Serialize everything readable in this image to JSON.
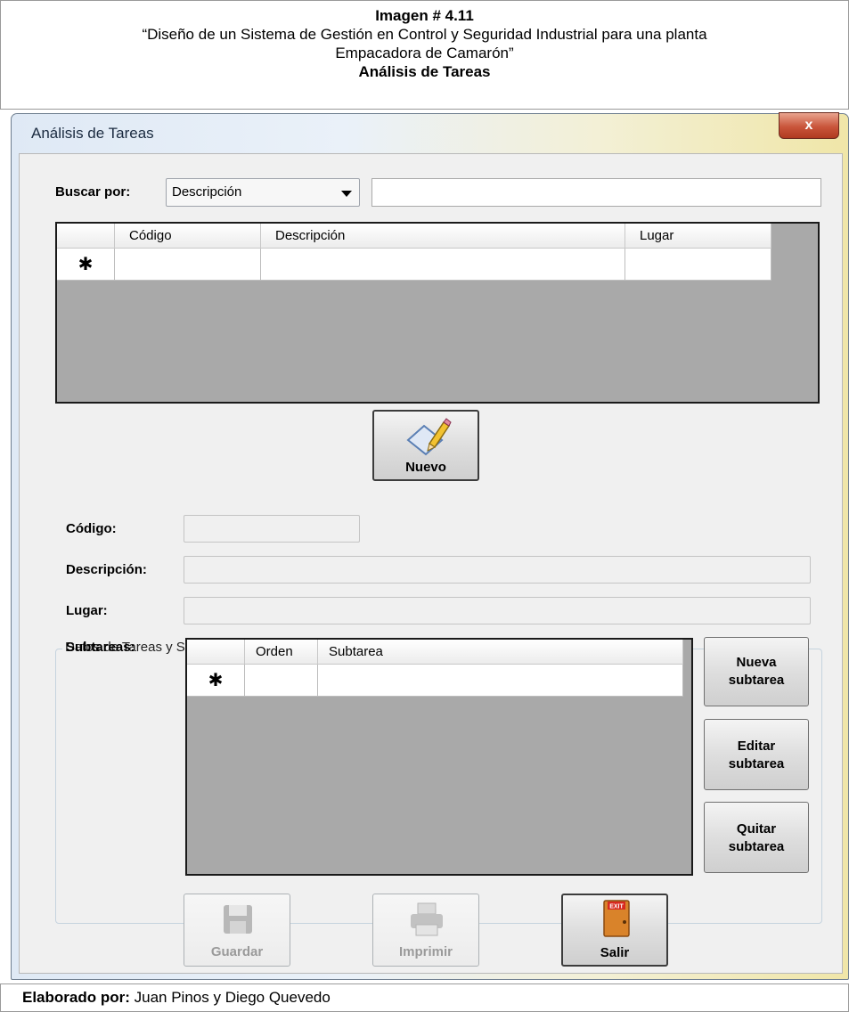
{
  "caption": {
    "line1": "Imagen # 4.11",
    "line2": "“Diseño de un Sistema de Gestión en Control y Seguridad Industrial para una planta",
    "line3": "Empacadora de Camarón”",
    "line4": "Análisis de Tareas"
  },
  "window": {
    "title": "Análisis de Tareas",
    "close_glyph": "x"
  },
  "search": {
    "label": "Buscar por:",
    "combo_value": "Descripción",
    "text_value": ""
  },
  "main_grid": {
    "columns": [
      "Código",
      "Descripción",
      "Lugar"
    ],
    "new_row_marker": "✱"
  },
  "buttons": {
    "nuevo": "Nuevo",
    "nueva_subtarea": [
      "Nueva",
      "subtarea"
    ],
    "editar_subtarea": [
      "Editar",
      "subtarea"
    ],
    "quitar_subtarea": [
      "Quitar",
      "subtarea"
    ],
    "guardar": "Guardar",
    "imprimir": "Imprimir",
    "salir": "Salir",
    "exit_sign": "EXIT"
  },
  "details": {
    "group_title": "Datos de Tareas y Subtareas",
    "codigo_label": "Código:",
    "descripcion_label": "Descripción:",
    "lugar_label": "Lugar:",
    "subtareas_label": "Subtareas:"
  },
  "sub_grid": {
    "columns": [
      "Orden",
      "Subtarea"
    ],
    "new_row_marker": "✱"
  },
  "footer": {
    "label": "Elaborado por:",
    "value": " Juan Pinos y Diego Quevedo"
  },
  "colors": {
    "close_button": "#c9553b",
    "grid_background": "#a9a9a9",
    "form_background": "#f0f0f0"
  },
  "icons": [
    "pencil-edit-icon",
    "floppy-disk-icon",
    "printer-icon",
    "exit-door-icon"
  ]
}
